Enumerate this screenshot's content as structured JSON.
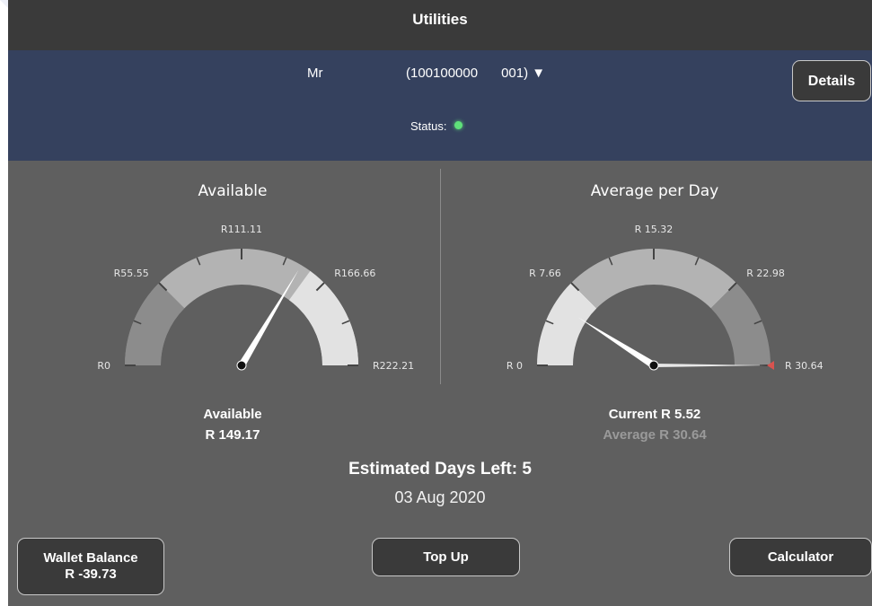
{
  "titlebar": {
    "title": "Utilities"
  },
  "account": {
    "name": "Mr",
    "number_part1": "(100100000",
    "number_part2": "001) ▼",
    "status_label": "Status:",
    "status_color": "#5fe07a"
  },
  "details_button": {
    "label": "Details"
  },
  "available_gauge": {
    "title": "Available",
    "ticks": [
      "R0",
      "R55.55",
      "R111.11",
      "R166.66",
      "R222.21"
    ],
    "value": 149.17,
    "max": 222.21,
    "info_label": "Available",
    "info_value": "R 149.17"
  },
  "average_gauge": {
    "title": "Average per Day",
    "ticks": [
      "R 0",
      "R 7.66",
      "R 15.32",
      "R 22.98",
      "R 30.64"
    ],
    "current": 5.52,
    "average": 30.64,
    "max": 30.64,
    "current_text": "Current R 5.52",
    "average_text": "Average R 30.64"
  },
  "estimate": {
    "days_text": "Estimated Days Left: 5",
    "date_text": "03 Aug 2020"
  },
  "buttons": {
    "wallet_line1": "Wallet Balance",
    "wallet_line2": "R -39.73",
    "topup": "Top Up",
    "calculator": "Calculator"
  },
  "colors": {
    "band_dark": "#8c8c8c",
    "band_mid": "#b3b3b3",
    "band_light": "#e2e2e2",
    "needle": "#ffffff",
    "average_marker": "#d9534f"
  }
}
